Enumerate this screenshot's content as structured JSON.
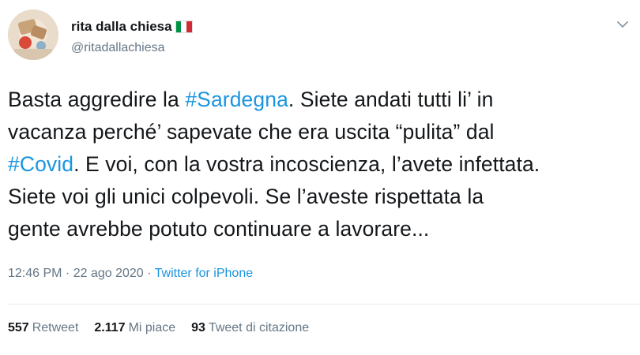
{
  "user": {
    "display_name": "rita dalla chiesa",
    "handle": "@ritadallachiesa",
    "flag_colors": [
      "#009246",
      "#ffffff",
      "#ce2b37"
    ]
  },
  "tweet": {
    "lines": [
      [
        {
          "t": "Basta aggredire la "
        },
        {
          "t": "#Sardegna",
          "tag": true
        },
        {
          "t": ". Siete andati tutti li’ in"
        }
      ],
      [
        {
          "t": "vacanza perché’ sapevate che era uscita “pulita” dal"
        }
      ],
      [
        {
          "t": "#Covid",
          "tag": true
        },
        {
          "t": ". E voi, con la vostra incoscienza, l’avete infettata."
        }
      ],
      [
        {
          "t": "Siete voi gli unici colpevoli. Se l’aveste rispettata la"
        }
      ],
      [
        {
          "t": "gente avrebbe potuto continuare a lavorare..."
        }
      ]
    ],
    "time": "12:46 PM",
    "date": "22 ago 2020",
    "separator": " · ",
    "source": "Twitter for iPhone"
  },
  "stats": [
    {
      "count": "557",
      "label": "Retweet"
    },
    {
      "count": "2.117",
      "label": "Mi piace"
    },
    {
      "count": "93",
      "label": "Tweet di citazione"
    }
  ],
  "colors": {
    "link": "#1b95e0",
    "secondary": "#657786",
    "text": "#14171a"
  },
  "icons": {
    "menu": "chevron-down-icon"
  }
}
